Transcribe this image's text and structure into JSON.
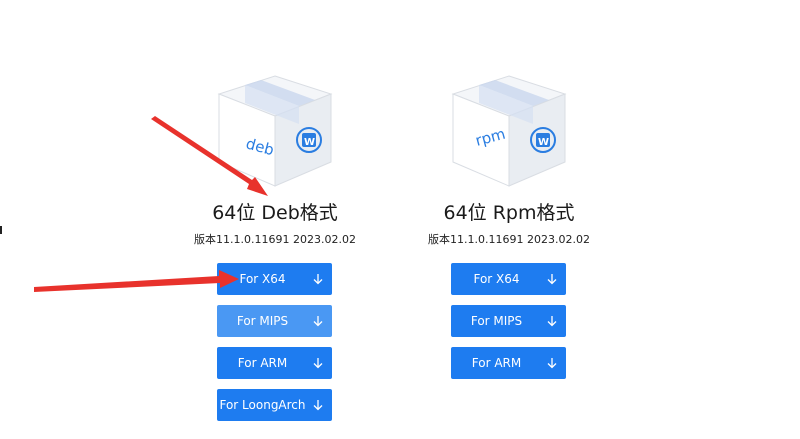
{
  "packages": [
    {
      "box_label": "deb",
      "title": "64位 Deb格式",
      "version": "版本11.1.0.11691 2023.02.02",
      "buttons": [
        "For X64",
        "For MIPS",
        "For ARM",
        "For LoongArch"
      ]
    },
    {
      "box_label": "rpm",
      "title": "64位 Rpm格式",
      "version": "版本11.1.0.11691 2023.02.02",
      "buttons": [
        "For X64",
        "For MIPS",
        "For ARM"
      ]
    }
  ],
  "icons": {
    "package": "package-box-icon",
    "download": "download-arrow-icon",
    "brand": "wps-logo-icon"
  },
  "colors": {
    "button": "#1e7cf0",
    "button_hover": "#4a98f3",
    "annotation_arrow": "#e8322c",
    "box_label": "#2a7de1"
  }
}
